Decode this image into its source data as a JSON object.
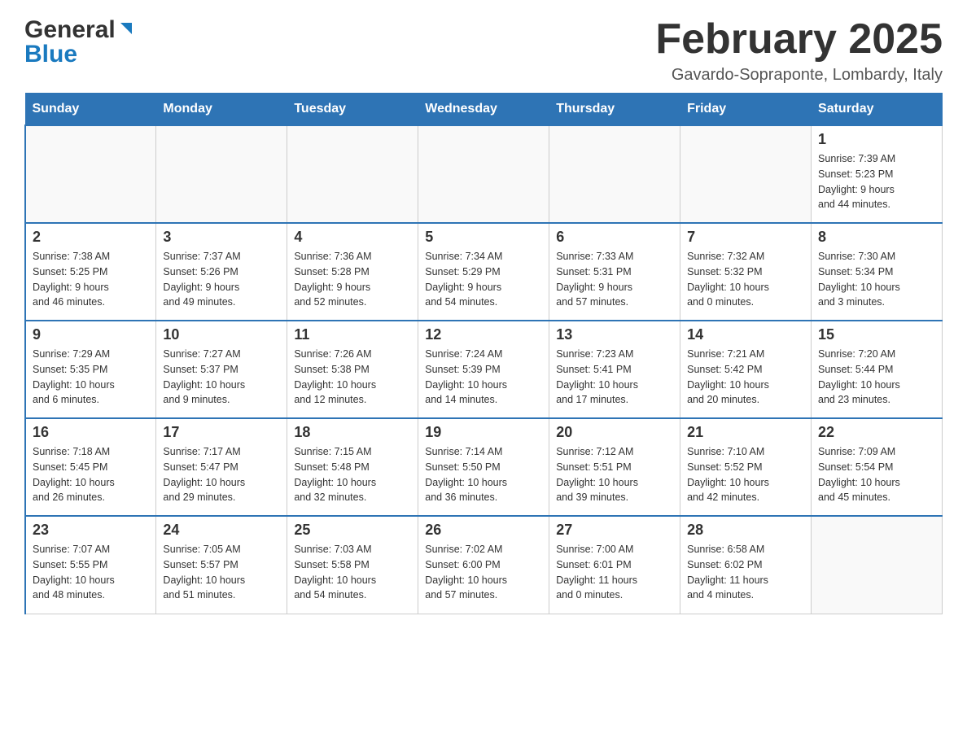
{
  "header": {
    "logo_general": "General",
    "logo_blue": "Blue",
    "title": "February 2025",
    "subtitle": "Gavardo-Sopraponte, Lombardy, Italy"
  },
  "days_of_week": [
    "Sunday",
    "Monday",
    "Tuesday",
    "Wednesday",
    "Thursday",
    "Friday",
    "Saturday"
  ],
  "weeks": [
    [
      {
        "day": "",
        "info": ""
      },
      {
        "day": "",
        "info": ""
      },
      {
        "day": "",
        "info": ""
      },
      {
        "day": "",
        "info": ""
      },
      {
        "day": "",
        "info": ""
      },
      {
        "day": "",
        "info": ""
      },
      {
        "day": "1",
        "info": "Sunrise: 7:39 AM\nSunset: 5:23 PM\nDaylight: 9 hours\nand 44 minutes."
      }
    ],
    [
      {
        "day": "2",
        "info": "Sunrise: 7:38 AM\nSunset: 5:25 PM\nDaylight: 9 hours\nand 46 minutes."
      },
      {
        "day": "3",
        "info": "Sunrise: 7:37 AM\nSunset: 5:26 PM\nDaylight: 9 hours\nand 49 minutes."
      },
      {
        "day": "4",
        "info": "Sunrise: 7:36 AM\nSunset: 5:28 PM\nDaylight: 9 hours\nand 52 minutes."
      },
      {
        "day": "5",
        "info": "Sunrise: 7:34 AM\nSunset: 5:29 PM\nDaylight: 9 hours\nand 54 minutes."
      },
      {
        "day": "6",
        "info": "Sunrise: 7:33 AM\nSunset: 5:31 PM\nDaylight: 9 hours\nand 57 minutes."
      },
      {
        "day": "7",
        "info": "Sunrise: 7:32 AM\nSunset: 5:32 PM\nDaylight: 10 hours\nand 0 minutes."
      },
      {
        "day": "8",
        "info": "Sunrise: 7:30 AM\nSunset: 5:34 PM\nDaylight: 10 hours\nand 3 minutes."
      }
    ],
    [
      {
        "day": "9",
        "info": "Sunrise: 7:29 AM\nSunset: 5:35 PM\nDaylight: 10 hours\nand 6 minutes."
      },
      {
        "day": "10",
        "info": "Sunrise: 7:27 AM\nSunset: 5:37 PM\nDaylight: 10 hours\nand 9 minutes."
      },
      {
        "day": "11",
        "info": "Sunrise: 7:26 AM\nSunset: 5:38 PM\nDaylight: 10 hours\nand 12 minutes."
      },
      {
        "day": "12",
        "info": "Sunrise: 7:24 AM\nSunset: 5:39 PM\nDaylight: 10 hours\nand 14 minutes."
      },
      {
        "day": "13",
        "info": "Sunrise: 7:23 AM\nSunset: 5:41 PM\nDaylight: 10 hours\nand 17 minutes."
      },
      {
        "day": "14",
        "info": "Sunrise: 7:21 AM\nSunset: 5:42 PM\nDaylight: 10 hours\nand 20 minutes."
      },
      {
        "day": "15",
        "info": "Sunrise: 7:20 AM\nSunset: 5:44 PM\nDaylight: 10 hours\nand 23 minutes."
      }
    ],
    [
      {
        "day": "16",
        "info": "Sunrise: 7:18 AM\nSunset: 5:45 PM\nDaylight: 10 hours\nand 26 minutes."
      },
      {
        "day": "17",
        "info": "Sunrise: 7:17 AM\nSunset: 5:47 PM\nDaylight: 10 hours\nand 29 minutes."
      },
      {
        "day": "18",
        "info": "Sunrise: 7:15 AM\nSunset: 5:48 PM\nDaylight: 10 hours\nand 32 minutes."
      },
      {
        "day": "19",
        "info": "Sunrise: 7:14 AM\nSunset: 5:50 PM\nDaylight: 10 hours\nand 36 minutes."
      },
      {
        "day": "20",
        "info": "Sunrise: 7:12 AM\nSunset: 5:51 PM\nDaylight: 10 hours\nand 39 minutes."
      },
      {
        "day": "21",
        "info": "Sunrise: 7:10 AM\nSunset: 5:52 PM\nDaylight: 10 hours\nand 42 minutes."
      },
      {
        "day": "22",
        "info": "Sunrise: 7:09 AM\nSunset: 5:54 PM\nDaylight: 10 hours\nand 45 minutes."
      }
    ],
    [
      {
        "day": "23",
        "info": "Sunrise: 7:07 AM\nSunset: 5:55 PM\nDaylight: 10 hours\nand 48 minutes."
      },
      {
        "day": "24",
        "info": "Sunrise: 7:05 AM\nSunset: 5:57 PM\nDaylight: 10 hours\nand 51 minutes."
      },
      {
        "day": "25",
        "info": "Sunrise: 7:03 AM\nSunset: 5:58 PM\nDaylight: 10 hours\nand 54 minutes."
      },
      {
        "day": "26",
        "info": "Sunrise: 7:02 AM\nSunset: 6:00 PM\nDaylight: 10 hours\nand 57 minutes."
      },
      {
        "day": "27",
        "info": "Sunrise: 7:00 AM\nSunset: 6:01 PM\nDaylight: 11 hours\nand 0 minutes."
      },
      {
        "day": "28",
        "info": "Sunrise: 6:58 AM\nSunset: 6:02 PM\nDaylight: 11 hours\nand 4 minutes."
      },
      {
        "day": "",
        "info": ""
      }
    ]
  ]
}
